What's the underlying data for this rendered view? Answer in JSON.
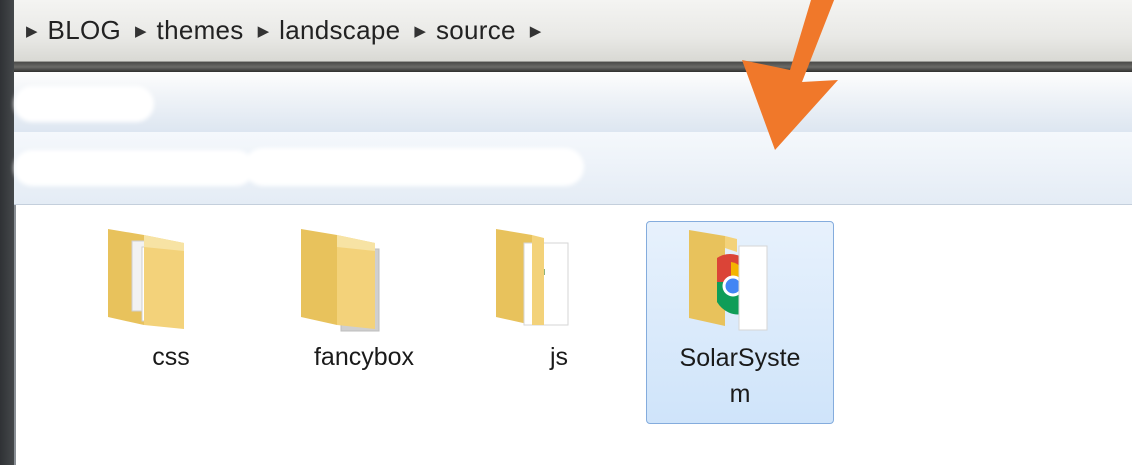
{
  "breadcrumb": [
    "BLOG",
    "themes",
    "landscape",
    "source"
  ],
  "files": [
    {
      "name": "css",
      "icon": "folder-icon"
    },
    {
      "name": "fancybox",
      "icon": "folder-icon"
    },
    {
      "name": "js",
      "icon": "folder-icon"
    },
    {
      "name_line1": "SolarSyste",
      "name_line2": "m",
      "icon": "folder-chrome-icon",
      "selected": true
    }
  ],
  "colors": {
    "arrow": "#f0782a",
    "selection": "#cfe4fa",
    "folder": "#f3d27a"
  }
}
